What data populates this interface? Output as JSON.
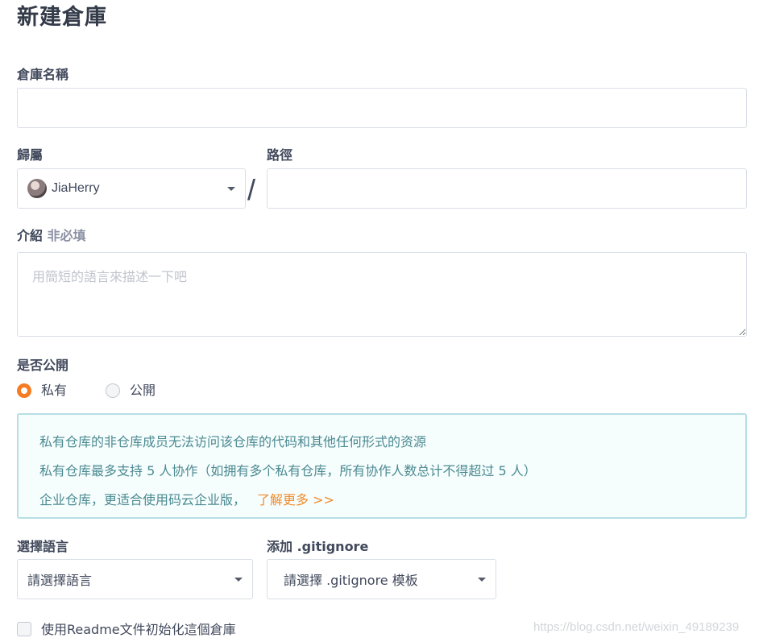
{
  "page": {
    "title": "新建倉庫"
  },
  "form": {
    "repo_name": {
      "label": "倉庫名稱",
      "value": ""
    },
    "owner": {
      "label": "歸屬",
      "selected": "JiaHerry",
      "avatar_icon": "user-avatar"
    },
    "separator": "/",
    "path": {
      "label": "路徑",
      "value": ""
    },
    "description": {
      "label": "介紹",
      "optional_label": "非必填",
      "placeholder": "用簡短的語言來描述一下吧",
      "value": ""
    },
    "visibility": {
      "label": "是否公開",
      "options": [
        {
          "label": "私有",
          "checked": true
        },
        {
          "label": "公開",
          "checked": false
        }
      ]
    },
    "notice": {
      "lines": [
        "私有仓库的非仓库成员无法访问该仓库的代码和其他任何形式的资源",
        "私有仓库最多支持 5 人协作（如拥有多个私有仓库，所有协作人数总计不得超过 5 人）",
        "企业仓库，更适合使用码云企业版，"
      ],
      "link_text": "了解更多 >>",
      "link_color": "#ef8c2b"
    },
    "language": {
      "label": "選擇語言",
      "selected": "請選擇語言"
    },
    "gitignore": {
      "label": "添加 .gitignore",
      "selected": "請選擇 .gitignore 模板"
    },
    "readme": {
      "label": "使用Readme文件初始化這個倉庫",
      "checked": false
    }
  },
  "watermark": "https://blog.csdn.net/weixin_49189239",
  "colors": {
    "accent": "#f57c23",
    "notice_bg": "#f6fdfd",
    "notice_border": "#b6dfe4",
    "notice_text": "#4b8a91"
  }
}
